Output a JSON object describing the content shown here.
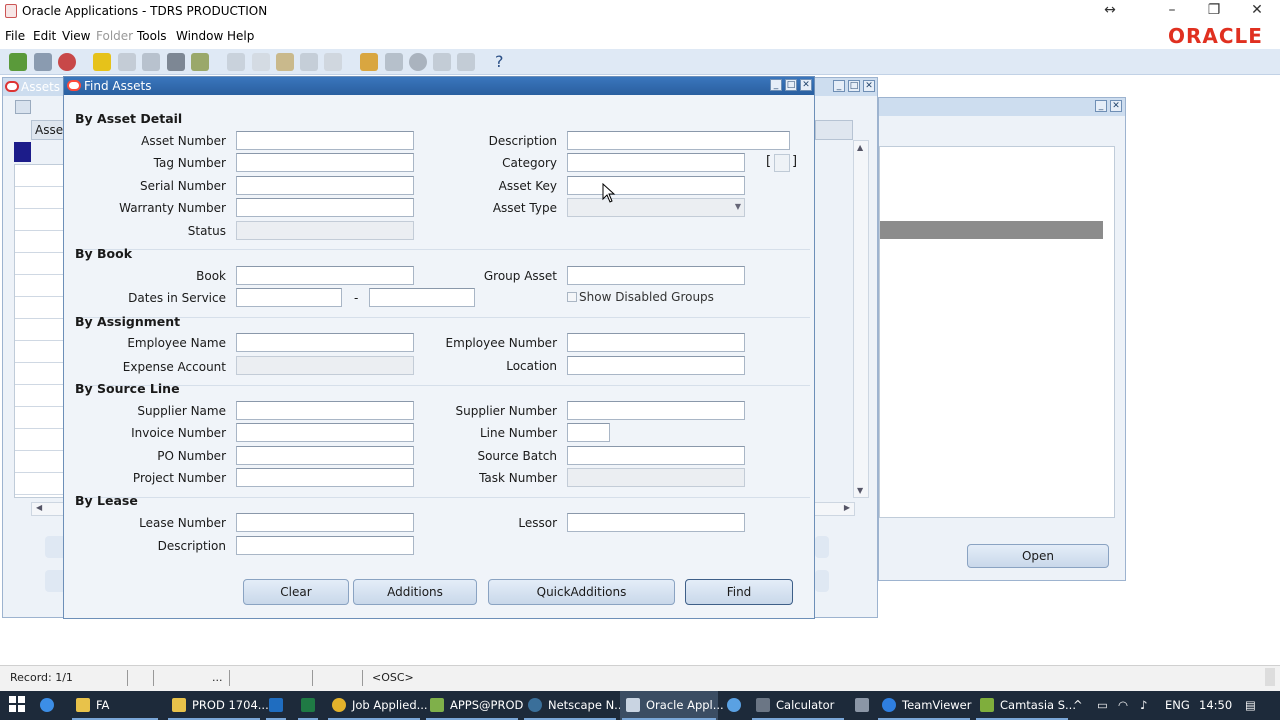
{
  "window": {
    "title": "Oracle Applications - TDRS PRODUCTION",
    "brand": "ORACLE"
  },
  "menu": [
    "File",
    "Edit",
    "View",
    "Folder",
    "Tools",
    "Window",
    "Help"
  ],
  "bg": {
    "assets_window_title": "Assets",
    "asset_col": "Asset",
    "open_button": "Open"
  },
  "dialog": {
    "title": "Find Assets",
    "by_asset_detail": "By Asset Detail",
    "asset_number": "Asset Number",
    "tag_number": "Tag Number",
    "serial_number": "Serial Number",
    "warranty_number": "Warranty Number",
    "status": "Status",
    "description": "Description",
    "category": "Category",
    "asset_key": "Asset Key",
    "asset_type": "Asset Type",
    "by_book": "By Book",
    "book": "Book",
    "dates_in_service": "Dates in Service",
    "date_sep": "-",
    "group_asset": "Group Asset",
    "show_disabled_groups": "Show Disabled Groups",
    "by_assignment": "By Assignment",
    "employee_name": "Employee Name",
    "expense_account": "Expense Account",
    "employee_number": "Employee Number",
    "location": "Location",
    "by_source_line": "By Source Line",
    "supplier_name": "Supplier Name",
    "invoice_number": "Invoice Number",
    "po_number": "PO Number",
    "project_number": "Project Number",
    "supplier_number": "Supplier Number",
    "line_number": "Line Number",
    "source_batch": "Source Batch",
    "task_number": "Task Number",
    "by_lease": "By Lease",
    "lease_number": "Lease Number",
    "lease_description": "Description",
    "lessor": "Lessor",
    "btn_clear": "Clear",
    "btn_additions": "Additions",
    "btn_quickadditions": "QuickAdditions",
    "btn_find": "Find",
    "dff_left": "[",
    "dff_right": "]"
  },
  "status": {
    "record": "Record: 1/1",
    "dots": "...",
    "osc": "<OSC>"
  },
  "taskbar": {
    "items": [
      "FA",
      "PROD 1704...",
      "Job Applied...",
      "APPS@PROD",
      "Netscape N...",
      "Oracle Appl...",
      "Calculator",
      "TeamViewer",
      "Camtasia S..."
    ],
    "lang": "ENG",
    "time": "14:50"
  },
  "colors": {
    "title_blue": "#2f67aa",
    "oracle_red": "#e03020",
    "taskbar": "#1d2a3a"
  }
}
